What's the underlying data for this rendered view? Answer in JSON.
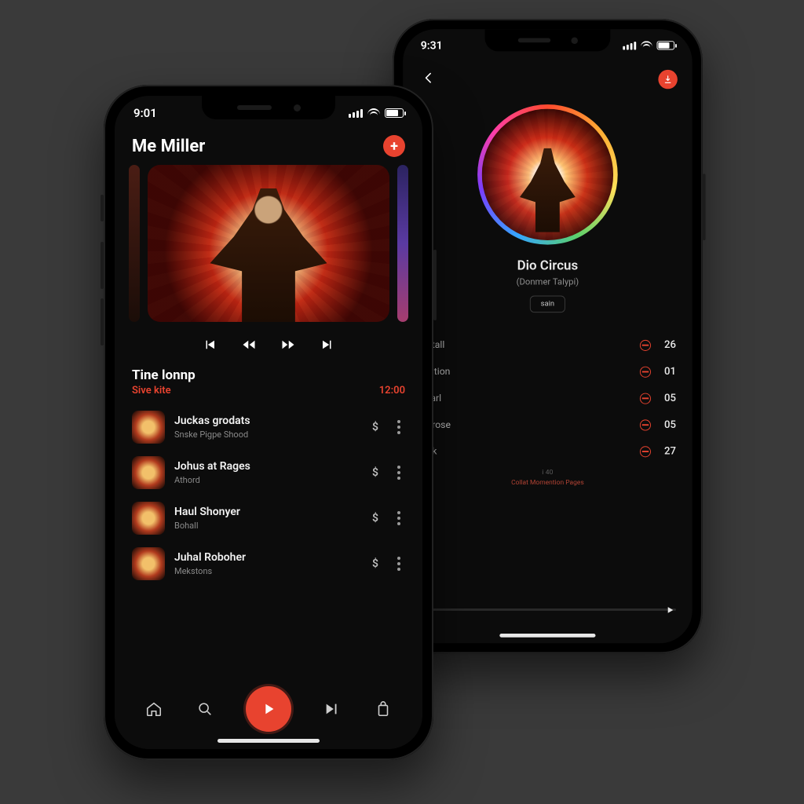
{
  "colors": {
    "accent": "#e8432f",
    "bg": "#0c0c0c"
  },
  "phoneA": {
    "status_time": "9:01",
    "header_title": "Me Miller",
    "section_title": "Tine lonnp",
    "section_sub_left": "Sive kite",
    "section_sub_right": "12:00",
    "tracks": [
      {
        "title": "Juckas grodats",
        "subtitle": "Snske Pigpe Shood"
      },
      {
        "title": "Johus at Rages",
        "subtitle": "Athord"
      },
      {
        "title": "Haul Shonyer",
        "subtitle": "Bohall"
      },
      {
        "title": "Juhal Roboher",
        "subtitle": "Mekstons"
      }
    ]
  },
  "phoneB": {
    "status_time": "9:31",
    "album_title": "Dio Circus",
    "album_subtitle": "(Donmer Talypi)",
    "chip_label": "sain",
    "tracks": [
      {
        "title": "lastall",
        "num": "26"
      },
      {
        "title": "dziition",
        "num": "01"
      },
      {
        "title": "Dearl",
        "num": "05"
      },
      {
        "title": "ularose",
        "num": "05"
      },
      {
        "title": "Julk",
        "num": "27"
      }
    ],
    "meta_small": "i  40",
    "meta_caption": "Collat Momention Pages"
  }
}
